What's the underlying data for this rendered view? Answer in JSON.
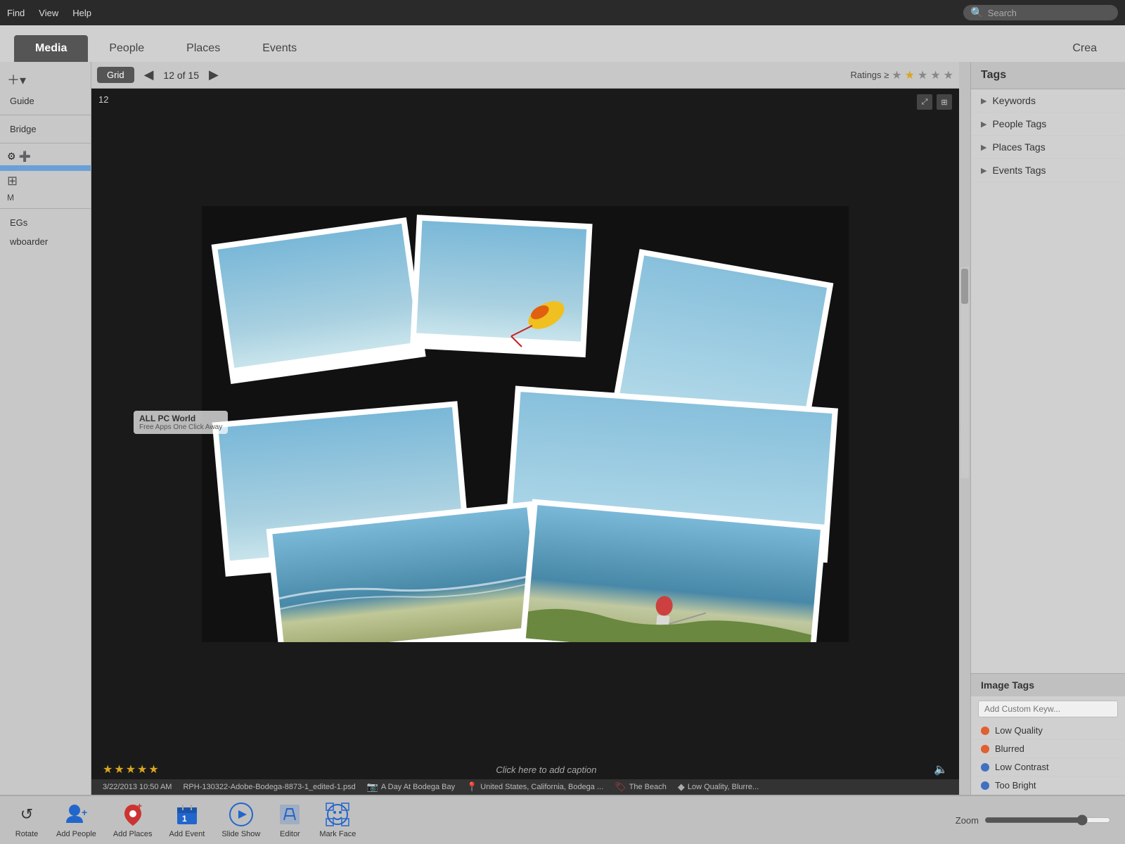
{
  "menu": {
    "find": "Find",
    "view": "View",
    "help": "Help",
    "search_placeholder": "Search"
  },
  "tabs": {
    "media": "Media",
    "people": "People",
    "places": "Places",
    "events": "Events",
    "create": "Crea"
  },
  "toolbar": {
    "grid_label": "Grid",
    "nav_prev": "◀",
    "nav_next": "▶",
    "count": "12 of 15",
    "ratings_label": "Ratings ≥"
  },
  "sidebar": {
    "add_btn": "＋▾",
    "items": [
      {
        "label": "Guide"
      },
      {
        "label": "Bridge"
      }
    ],
    "section1_label": "⚙ ＋",
    "selected_row": "",
    "tag_items": [
      {
        "label": "EGs"
      },
      {
        "label": "wboarder"
      }
    ]
  },
  "image_viewer": {
    "number": "12",
    "caption": "Click here to add caption",
    "stars": [
      "★",
      "★",
      "★",
      "★",
      "★"
    ],
    "date_time": "3/22/2013 10:50 AM",
    "filename": "RPH-130322-Adobe-Bodega-8873-1_edited-1.psd",
    "location": "A Day At Bodega Bay",
    "country": "United States, California, Bodega ...",
    "beach_tag": "The Beach",
    "quality_tag": "Low Quality, Blurre..."
  },
  "watermark": {
    "title": "ALL PC World",
    "subtitle": "Free Apps One Click Away"
  },
  "tags_panel": {
    "title": "Tags",
    "sections": [
      {
        "label": "Keywords"
      },
      {
        "label": "People Tags"
      },
      {
        "label": "Places Tags"
      },
      {
        "label": "Events Tags"
      }
    ]
  },
  "image_tags": {
    "title": "Image Tags",
    "input_placeholder": "Add Custom Keyw...",
    "items": [
      {
        "label": "Low Quality",
        "color": "orange"
      },
      {
        "label": "Blurred",
        "color": "orange"
      },
      {
        "label": "Low Contrast",
        "color": "blue"
      },
      {
        "label": "Too Bright",
        "color": "blue"
      }
    ]
  },
  "bottom_tools": [
    {
      "label": "Rotate",
      "icon": "↺"
    },
    {
      "label": "Add People",
      "icon": "👤+"
    },
    {
      "label": "Add Places",
      "icon": "📍+"
    },
    {
      "label": "Add Event",
      "icon": "📅"
    },
    {
      "label": "Slide Show",
      "icon": "▶"
    },
    {
      "label": "Editor",
      "icon": "✂"
    },
    {
      "label": "Mark Face",
      "icon": "😊"
    }
  ],
  "zoom": {
    "label": "Zoom",
    "value": 80
  }
}
